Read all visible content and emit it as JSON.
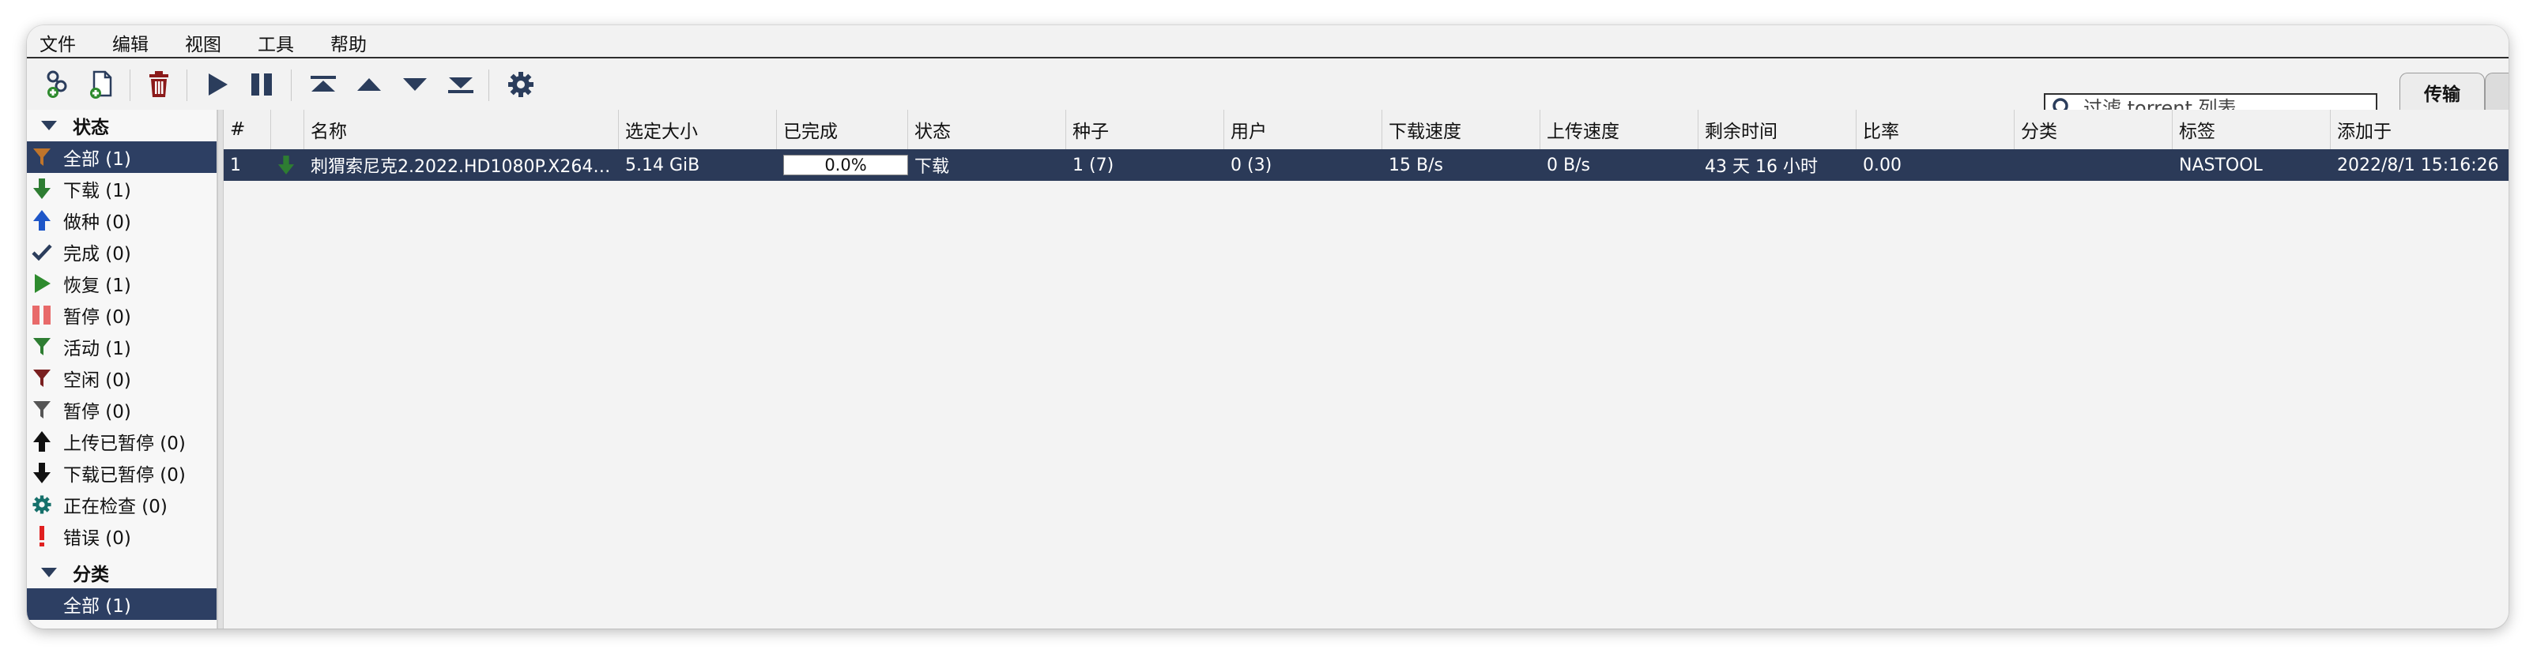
{
  "menu": [
    "文件",
    "编辑",
    "视图",
    "工具",
    "帮助"
  ],
  "search": {
    "placeholder": "过滤 torrent 列表..."
  },
  "tabs": {
    "active": "传输"
  },
  "sidebar": {
    "status_header": "状态",
    "status_items": [
      {
        "label": "全部 (1)",
        "icon": "filter-icon",
        "color": "#c0752b",
        "selected": true
      },
      {
        "label": "下载 (1)",
        "icon": "download-arrow-icon",
        "color": "#2e7d32"
      },
      {
        "label": "做种 (0)",
        "icon": "upload-arrow-icon",
        "color": "#1e56c8"
      },
      {
        "label": "完成 (0)",
        "icon": "check-icon",
        "color": "#2b3d5c"
      },
      {
        "label": "恢复 (1)",
        "icon": "play-icon",
        "color": "#2e8b2e"
      },
      {
        "label": "暂停 (0)",
        "icon": "pause-icon",
        "color": "#e86a6a"
      },
      {
        "label": "活动 (1)",
        "icon": "filter-icon",
        "color": "#2e7d32"
      },
      {
        "label": "空闲 (0)",
        "icon": "filter-icon",
        "color": "#7a2020"
      },
      {
        "label": "暂停 (0)",
        "icon": "filter-icon",
        "color": "#555555"
      },
      {
        "label": "上传已暂停 (0)",
        "icon": "upload-arrow-icon",
        "color": "#111111"
      },
      {
        "label": "下载已暂停 (0)",
        "icon": "download-arrow-icon",
        "color": "#111111"
      },
      {
        "label": "正在检查 (0)",
        "icon": "gear-icon",
        "color": "#16706b"
      },
      {
        "label": "错误 (0)",
        "icon": "error-icon",
        "color": "#e02020"
      }
    ],
    "category_header": "分类",
    "category_items": [
      {
        "label": "全部 (1)",
        "selected": true
      }
    ]
  },
  "table": {
    "columns": [
      "#",
      "",
      "名称",
      "选定大小",
      "已完成",
      "状态",
      "种子",
      "用户",
      "下载速度",
      "上传速度",
      "剩余时间",
      "比率",
      "分类",
      "标签",
      "添加于"
    ],
    "rows": [
      {
        "num": "1",
        "name": "刺猬索尼克2.2022.HD1080P.X264…",
        "size": "5.14 GiB",
        "progress": 0.0,
        "progress_text": "0.0%",
        "status": "下载",
        "seeds": "1 (7)",
        "peers": "0 (3)",
        "dlspeed": "15 B/s",
        "upspeed": "0 B/s",
        "eta": "43 天 16 小时",
        "ratio": "0.00",
        "category": "",
        "tags": "NASTOOL",
        "added": "2022/8/1 15:16:26"
      }
    ]
  },
  "colors": {
    "accent": "#2d3f63",
    "selected_row": "#2b3a58",
    "toolbar_icon": "#2b3d5c",
    "delete": "#8b1a1a"
  }
}
